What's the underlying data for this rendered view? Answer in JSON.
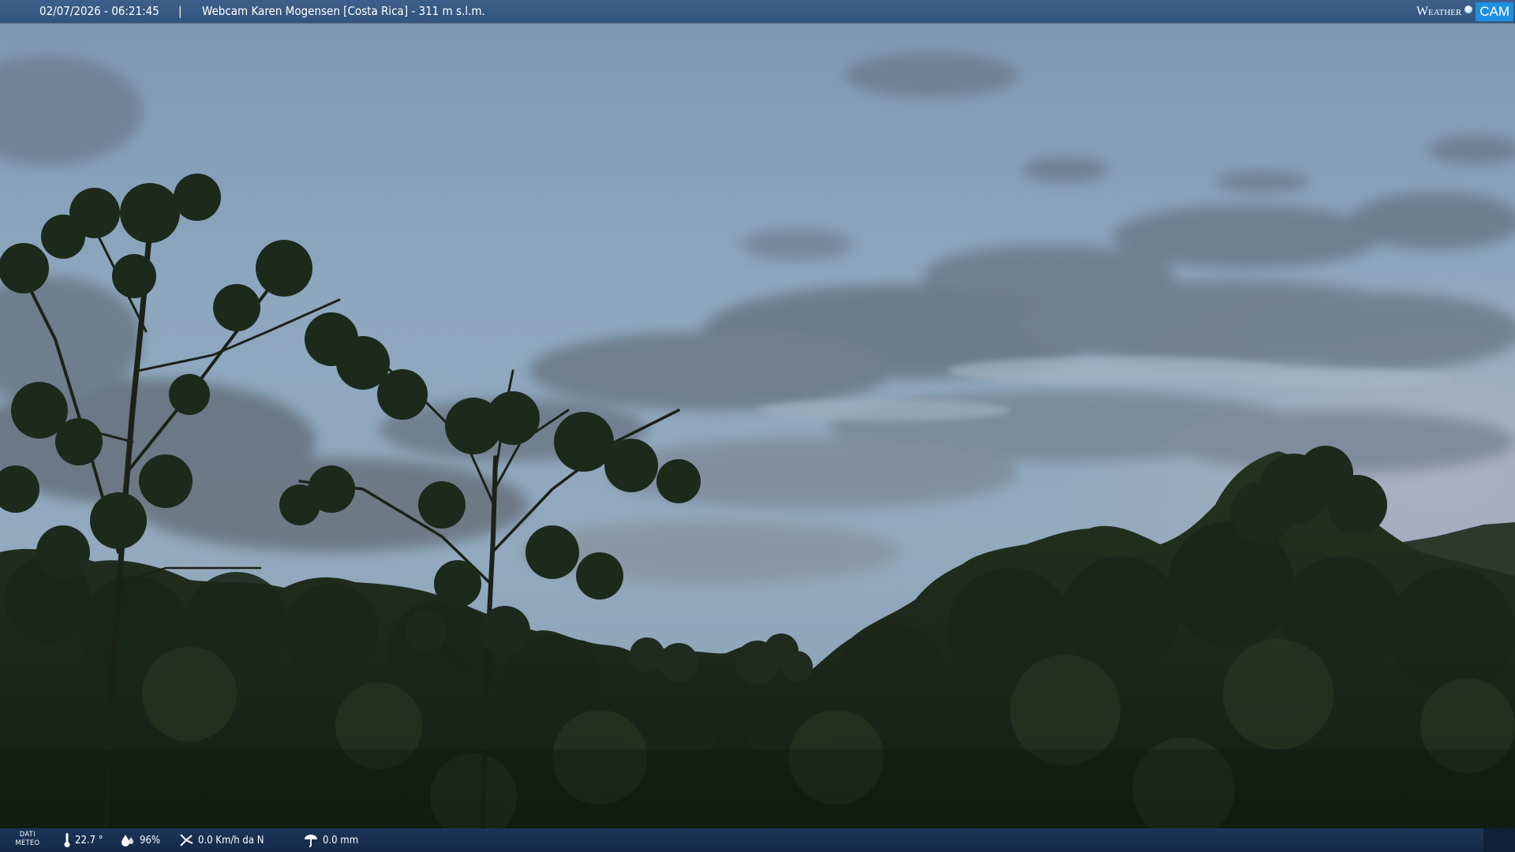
{
  "topbar": {
    "datetime": "02/07/2026 - 06:21:45",
    "separator": "|",
    "title": "Webcam Karen Mogensen [Costa Rica]  - 311 m s.l.m."
  },
  "brand": {
    "word": "Weather",
    "box": "CAM"
  },
  "bottombar": {
    "label_line1": "DATI",
    "label_line2": "METEO",
    "temperature": "22.7 °",
    "humidity": "96%",
    "wind": "0.0 Km/h da N",
    "rain": "0.0 mm"
  },
  "icons": {
    "temperature": "thermometer-icon",
    "humidity": "humidity-drop-icon",
    "wind": "wind-icon",
    "rain": "rain-gauge-icon"
  },
  "colors": {
    "topbar": "#3a5c87",
    "bottombar": "#172e4d",
    "sky": "#8aa4bd",
    "forest": "#1c2a1e"
  }
}
